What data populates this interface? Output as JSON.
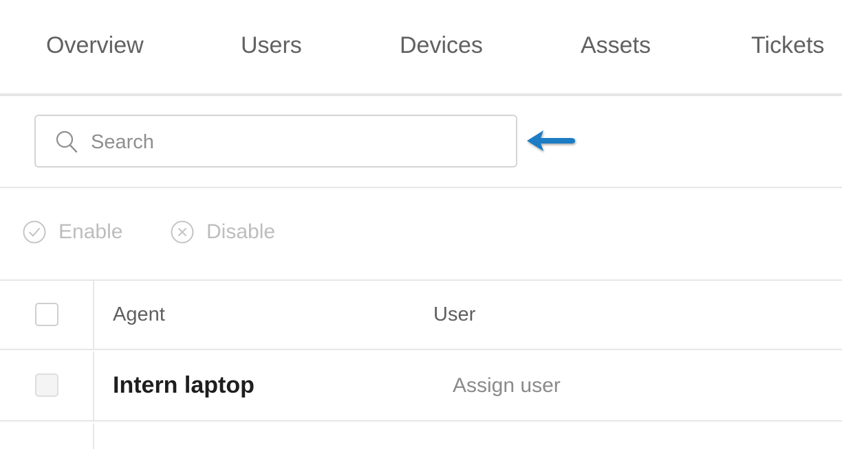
{
  "tabs": [
    {
      "label": "Overview"
    },
    {
      "label": "Users"
    },
    {
      "label": "Devices"
    },
    {
      "label": "Assets"
    },
    {
      "label": "Tickets"
    }
  ],
  "search": {
    "placeholder": "Search",
    "value": "",
    "icon": "search-icon"
  },
  "annotation": {
    "icon": "arrow-left-icon",
    "color": "#1a7bc4"
  },
  "actions": {
    "enable": {
      "label": "Enable",
      "icon": "check-circle-icon"
    },
    "disable": {
      "label": "Disable",
      "icon": "x-circle-icon"
    }
  },
  "table": {
    "columns": [
      "Agent",
      "User"
    ],
    "rows": [
      {
        "agent": "Intern laptop",
        "user": "Assign user"
      }
    ]
  },
  "colors": {
    "tab_text": "#616161",
    "disabled_text": "#bdbdbd",
    "divider": "#e6e6e6",
    "accent_arrow": "#1a7bc4"
  }
}
